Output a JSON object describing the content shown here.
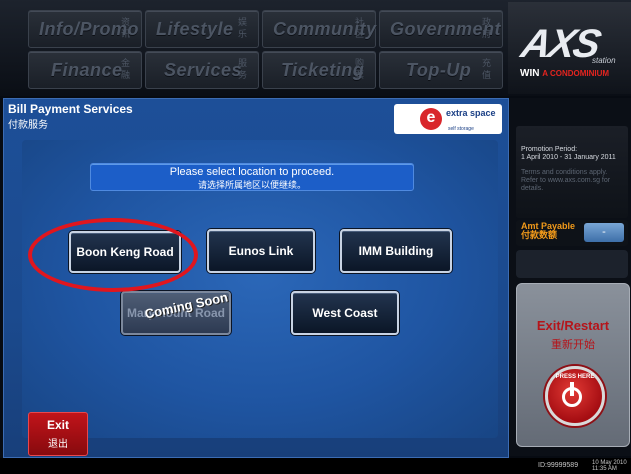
{
  "top_menu": {
    "row1": [
      {
        "label": "Info/Promo",
        "cn": "资讯"
      },
      {
        "label": "Lifestyle",
        "cn": "娱乐"
      },
      {
        "label": "Community",
        "cn": "社区"
      },
      {
        "label": "Government",
        "cn": "政府"
      }
    ],
    "row2": [
      {
        "label": "Finance",
        "cn": "金融"
      },
      {
        "label": "Services",
        "cn": "服务"
      },
      {
        "label": "Ticketing",
        "cn": "购票"
      },
      {
        "label": "Top-Up",
        "cn": "充值"
      }
    ]
  },
  "logo": {
    "brand": "AXS",
    "sub": "station",
    "win": "WIN",
    "tagline": "A CONDOMINIUM"
  },
  "main": {
    "title": "Bill Payment Services",
    "title_cn": "付款服务",
    "partner_logo": "extra space",
    "partner_small": "self storage",
    "instruction": "Please select location to proceed.",
    "instruction_cn": "请选择所属地区以便继续。",
    "locations": [
      {
        "label": "Boon Keng Road",
        "enabled": true
      },
      {
        "label": "Eunos Link",
        "enabled": true
      },
      {
        "label": "IMM Building",
        "enabled": true
      },
      {
        "label": "Marymount Road",
        "enabled": false
      },
      {
        "label": "West Coast",
        "enabled": true
      }
    ],
    "coming_soon": "Coming Soon",
    "exit_label": "Exit",
    "exit_cn": "退出"
  },
  "side": {
    "promo_period_title": "Promotion Period:",
    "promo_period": "1 April 2010 - 31 January 2011",
    "promo_terms": "Terms and conditions apply. Refer to www.axs.com.sg for details.",
    "amt_label": "Amt Payable",
    "amt_cn": "付款数额",
    "amt_value": "-",
    "exit_restart": "Exit/Restart",
    "exit_restart_cn": "重新开始",
    "press_here": "PRESS HERE"
  },
  "status": {
    "terminal_id": "ID:99999589",
    "date": "10 May 2010",
    "time": "11:35 AM"
  }
}
